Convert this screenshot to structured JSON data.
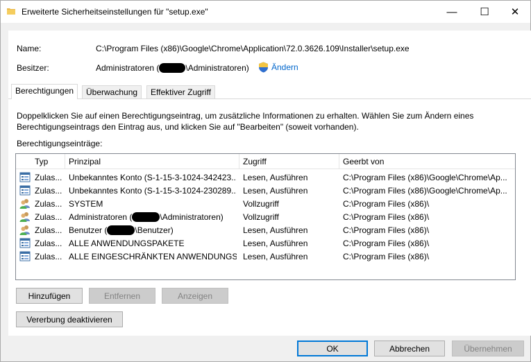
{
  "window": {
    "title": "Erweiterte Sicherheitseinstellungen für \"setup.exe\"",
    "controls": {
      "minimize": "—",
      "maximize": "☐",
      "close": "✕"
    }
  },
  "name_label": "Name:",
  "name_value": "C:\\Program Files (x86)\\Google\\Chrome\\Application\\72.0.3626.109\\Installer\\setup.exe",
  "owner_label": "Besitzer:",
  "owner_prefix": "Administratoren (",
  "owner_suffix": "\\Administratoren)",
  "change_link": "Ändern",
  "tabs": [
    {
      "label": "Berechtigungen",
      "active": true
    },
    {
      "label": "Überwachung",
      "active": false
    },
    {
      "label": "Effektiver Zugriff",
      "active": false
    }
  ],
  "info_text": "Doppelklicken Sie auf einen Berechtigungseintrag, um zusätzliche Informationen zu erhalten. Wählen Sie zum Ändern eines Berechtigungseintrags den Eintrag aus, und klicken Sie auf \"Bearbeiten\" (soweit vorhanden).",
  "entries_label": "Berechtigungseinträge:",
  "columns": [
    "Typ",
    "Prinzipal",
    "Zugriff",
    "Geerbt von"
  ],
  "rows": [
    {
      "icon": "app-package-icon",
      "type": "Zulas...",
      "principal": "Unbekanntes Konto (S-1-15-3-1024-342423...",
      "access": "Lesen, Ausführen",
      "inherited": "C:\\Program Files (x86)\\Google\\Chrome\\Ap..."
    },
    {
      "icon": "app-package-icon",
      "type": "Zulas...",
      "principal": "Unbekanntes Konto (S-1-15-3-1024-230289...",
      "access": "Lesen, Ausführen",
      "inherited": "C:\\Program Files (x86)\\Google\\Chrome\\Ap..."
    },
    {
      "icon": "users-group-icon",
      "type": "Zulas...",
      "principal": "SYSTEM",
      "access": "Vollzugriff",
      "inherited": "C:\\Program Files (x86)\\"
    },
    {
      "icon": "users-group-icon",
      "type": "Zulas...",
      "principal_prefix": "Administratoren (",
      "principal_suffix": "\\Administratoren)",
      "access": "Vollzugriff",
      "inherited": "C:\\Program Files (x86)\\"
    },
    {
      "icon": "users-group-icon",
      "type": "Zulas...",
      "principal_prefix": "Benutzer (",
      "principal_suffix": "\\Benutzer)",
      "access": "Lesen, Ausführen",
      "inherited": "C:\\Program Files (x86)\\"
    },
    {
      "icon": "app-package-icon",
      "type": "Zulas...",
      "principal": "ALLE ANWENDUNGSPAKETE",
      "access": "Lesen, Ausführen",
      "inherited": "C:\\Program Files (x86)\\"
    },
    {
      "icon": "app-package-icon",
      "type": "Zulas...",
      "principal": "ALLE EINGESCHRÄNKTEN ANWENDUNGSP...",
      "access": "Lesen, Ausführen",
      "inherited": "C:\\Program Files (x86)\\"
    }
  ],
  "buttons": {
    "add": "Hinzufügen",
    "remove": "Entfernen",
    "view": "Anzeigen",
    "disable_inheritance": "Vererbung deaktivieren",
    "ok": "OK",
    "cancel": "Abbrechen",
    "apply": "Übernehmen"
  },
  "colors": {
    "link": "#0066cc",
    "accent": "#0078d7"
  }
}
